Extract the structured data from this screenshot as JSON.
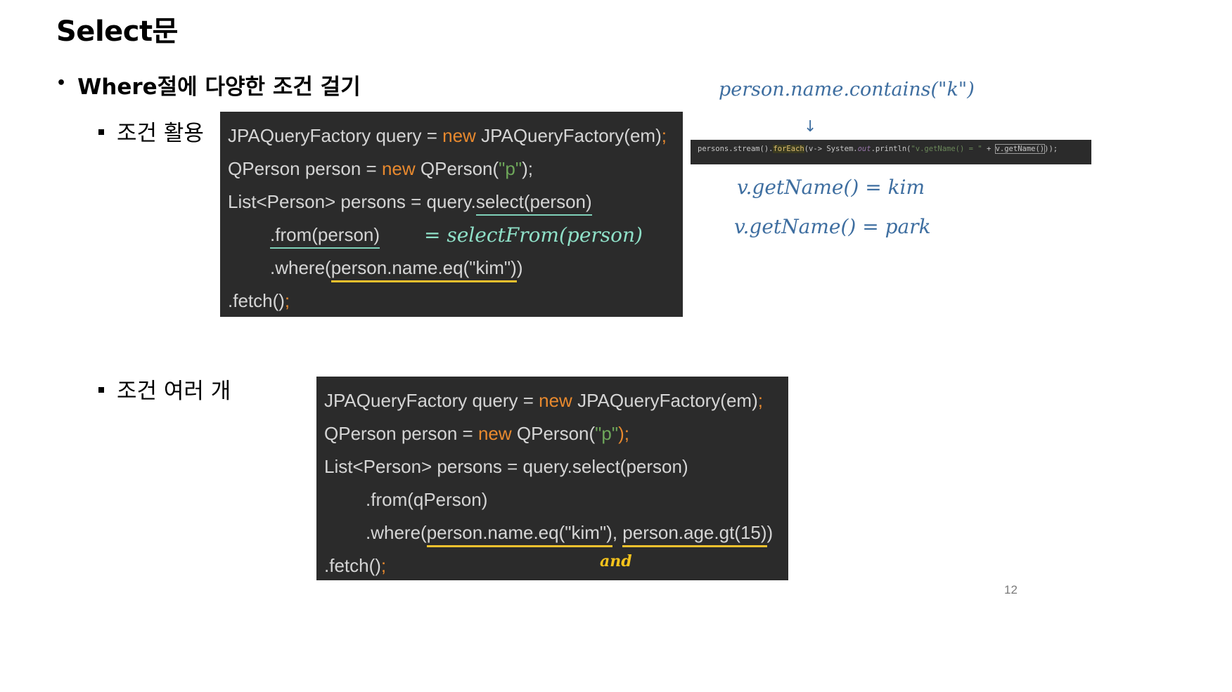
{
  "slide": {
    "title": "Select문",
    "bullet": "Where절에 다양한 조건 걸기",
    "sub_bullet_1": "조건 활용",
    "sub_bullet_2": "조건 여러 개",
    "page_number": "12"
  },
  "code1": {
    "l1_a": "JPAQueryFactory query = ",
    "l1_new": "new",
    "l1_b": " JPAQueryFactory(em)",
    "l1_semi": ";",
    "l2_a": "QPerson person = ",
    "l2_new": "new",
    "l2_b": " QPerson(",
    "l2_str": "\"p\"",
    "l2_c": ");",
    "l3_a": "List<Person> persons = query.",
    "l3_u": "select(person)",
    "l4_u": ".from(person)",
    "l5_a": ".where(",
    "l5_u": "person.name.eq(\"kim\")",
    "l5_b": ")",
    "l6_a": ".fetch()",
    "l6_semi": ";"
  },
  "code2": {
    "l1_a": "JPAQueryFactory query = ",
    "l1_new": "new",
    "l1_b": " JPAQueryFactory(em)",
    "l1_semi": ";",
    "l2_a": "QPerson person = ",
    "l2_new": "new",
    "l2_b": " QPerson(",
    "l2_str": "\"p\"",
    "l2_c": ");",
    "l3": "List<Person> persons = query.select(person)",
    "l4": ".from(qPerson)",
    "l5_a": ".where(",
    "l5_u1": "person.name.eq(\"kim\")",
    "l5_b": ", ",
    "l5_u2": "person.age.gt(15)",
    "l5_c": ")",
    "l6_a": ".fetch()",
    "l6_semi": ";"
  },
  "annotations": {
    "select_from": "= selectFrom(person)",
    "and": "and",
    "contains": "person.name.contains(\"k\")",
    "arrow": "↓",
    "result_kim": "v.getName() = kim",
    "result_park": "v.getName() = park"
  },
  "snippet": {
    "a": "persons.stream().",
    "foreach": "forEach",
    "b": "(v-> System.",
    "out": "out",
    "c": ".println(",
    "s": "\"v.getName() = \"",
    "d": " + ",
    "e": "v.getName()",
    "f": "));"
  },
  "colors": {
    "code_bg": "#2b2b2b",
    "keyword": "#e8892e",
    "string": "#6ea75a",
    "underline_teal": "#7fd1b9",
    "underline_yellow": "#f2c12e",
    "handwriting_blue": "#3e6ea0"
  }
}
